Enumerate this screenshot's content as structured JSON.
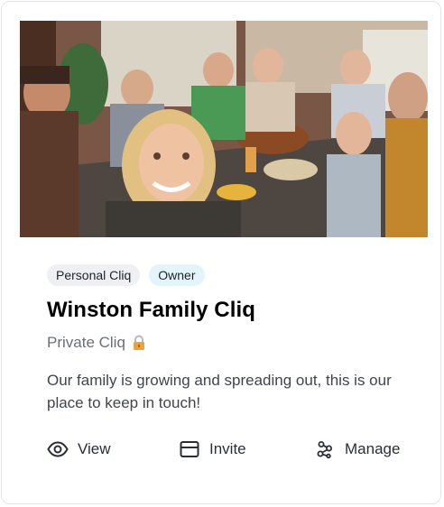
{
  "card": {
    "badges": [
      "Personal Cliq",
      "Owner"
    ],
    "title": "Winston Family Cliq",
    "privacy_label": "Private Cliq",
    "description": "Our family is growing and spreading out, this is our place to keep in touch!",
    "actions": {
      "view": "View",
      "invite": "Invite",
      "manage": "Manage"
    },
    "icons": {
      "view": "eye-icon",
      "invite": "card-icon",
      "manage": "nodes-icon",
      "privacy": "lock-icon"
    },
    "colors": {
      "owner_badge": "#e3f4fb",
      "personal_badge": "#eef0f3",
      "lock": "#e8a33a"
    }
  }
}
